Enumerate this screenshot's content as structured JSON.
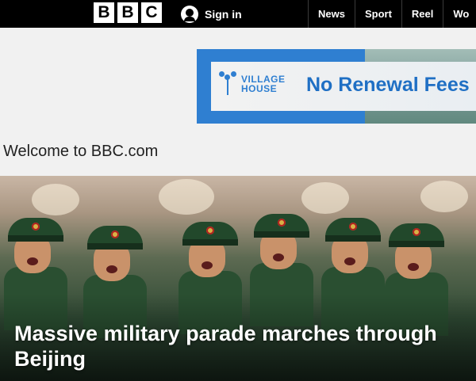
{
  "header": {
    "logo_letters": [
      "B",
      "B",
      "C"
    ],
    "signin_label": "Sign in",
    "nav_items": [
      "News",
      "Sport",
      "Reel",
      "Wo"
    ]
  },
  "ad": {
    "brand_line1": "VILLAGE",
    "brand_line2": "HOUSE",
    "headline": "No Renewal Fees",
    "colors": {
      "primary": "#2f7fd1"
    }
  },
  "main": {
    "welcome": "Welcome to BBC.com",
    "hero_headline": "Massive military parade marches through Beijing"
  },
  "icons": {
    "signin": "account-icon",
    "ad_logo": "village-house-logo-icon"
  }
}
